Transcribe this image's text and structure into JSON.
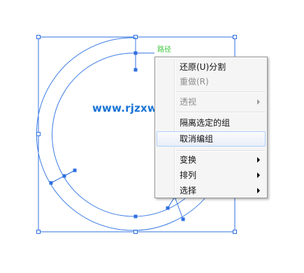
{
  "canvas": {
    "path_hint": "路径",
    "watermark": "www.rjzxw.com",
    "stroke_color": "#3d7de4",
    "anchor_color": "#2f6fe0"
  },
  "context_menu": {
    "items": [
      {
        "label": "还原(U)分割",
        "enabled": true,
        "submenu": false
      },
      {
        "label": "重做(R)",
        "enabled": false,
        "submenu": false
      },
      {
        "label": "透视",
        "enabled": false,
        "submenu": true
      },
      {
        "label": "隔离选定的组",
        "enabled": true,
        "submenu": false
      },
      {
        "label": "取消编组",
        "enabled": true,
        "submenu": false,
        "highlighted": true
      },
      {
        "label": "变换",
        "enabled": true,
        "submenu": true
      },
      {
        "label": "排列",
        "enabled": true,
        "submenu": true
      },
      {
        "label": "选择",
        "enabled": true,
        "submenu": true
      }
    ]
  }
}
